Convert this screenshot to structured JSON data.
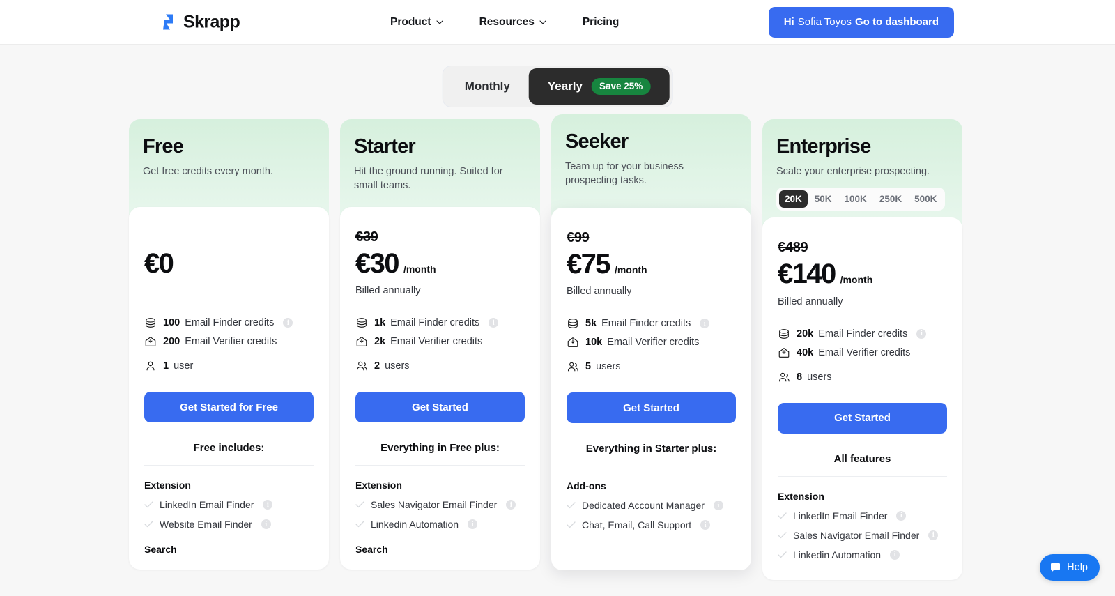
{
  "header": {
    "logo_text": "Skrapp",
    "nav": [
      {
        "label": "Product",
        "has_chevron": true
      },
      {
        "label": "Resources",
        "has_chevron": true
      },
      {
        "label": "Pricing",
        "has_chevron": false
      }
    ],
    "cta": {
      "greeting": "Hi",
      "username": "Sofia Toyos",
      "action": "Go to dashboard"
    },
    "accent_color": "#386bf0"
  },
  "billing_toggle": {
    "monthly_label": "Monthly",
    "yearly_label": "Yearly",
    "save_badge": "Save 25%",
    "selected": "Yearly",
    "badge_color": "#17853f",
    "active_bg": "#2c2c2c"
  },
  "plans": [
    {
      "name": "Free",
      "description": "Get free credits every month.",
      "price_old": "",
      "price": "€0",
      "per": "",
      "billed": "",
      "credits": [
        {
          "amount": "100",
          "label": "Email Finder credits",
          "info": true,
          "icon": "coins-icon"
        },
        {
          "amount": "200",
          "label": "Email Verifier credits",
          "info": false,
          "icon": "envelope-download-icon"
        }
      ],
      "users": {
        "amount": "1",
        "label": "user",
        "icon": "user-icon"
      },
      "cta_label": "Get Started for Free",
      "includes_title": "Free includes:",
      "feature_groups": [
        {
          "title": "Extension",
          "items": [
            {
              "label": "LinkedIn Email Finder",
              "info": true
            },
            {
              "label": "Website Email Finder",
              "info": true
            }
          ]
        },
        {
          "title": "Search",
          "items": []
        }
      ]
    },
    {
      "name": "Starter",
      "description": "Hit the ground running. Suited for small teams.",
      "price_old": "€39",
      "price": "€30",
      "per": "/month",
      "billed": "Billed annually",
      "credits": [
        {
          "amount": "1k",
          "label": "Email Finder credits",
          "info": true,
          "icon": "coins-icon"
        },
        {
          "amount": "2k",
          "label": "Email Verifier credits",
          "info": false,
          "icon": "envelope-download-icon"
        }
      ],
      "users": {
        "amount": "2",
        "label": "users",
        "icon": "users-icon"
      },
      "cta_label": "Get Started",
      "includes_title": "Everything in Free plus:",
      "feature_groups": [
        {
          "title": "Extension",
          "items": [
            {
              "label": "Sales Navigator Email Finder",
              "info": true
            },
            {
              "label": "Linkedin Automation",
              "info": true
            }
          ]
        },
        {
          "title": "Search",
          "items": []
        }
      ]
    },
    {
      "name": "Seeker",
      "description": "Team up for your business prospecting tasks.",
      "price_old": "€99",
      "price": "€75",
      "per": "/month",
      "billed": "Billed annually",
      "credits": [
        {
          "amount": "5k",
          "label": "Email Finder credits",
          "info": true,
          "icon": "coins-icon"
        },
        {
          "amount": "10k",
          "label": "Email Verifier credits",
          "info": false,
          "icon": "envelope-download-icon"
        }
      ],
      "users": {
        "amount": "5",
        "label": "users",
        "icon": "users-icon"
      },
      "cta_label": "Get Started",
      "includes_title": "Everything in Starter plus:",
      "feature_groups": [
        {
          "title": "Add-ons",
          "items": [
            {
              "label": "Dedicated Account Manager",
              "info": true
            },
            {
              "label": "Chat, Email, Call Support",
              "info": true
            }
          ]
        }
      ]
    },
    {
      "name": "Enterprise",
      "description": "Scale your enterprise prospecting.",
      "tiers": [
        "20K",
        "50K",
        "100K",
        "250K",
        "500K"
      ],
      "tier_selected": "20K",
      "price_old": "€489",
      "price": "€140",
      "per": "/month",
      "billed": "Billed annually",
      "credits": [
        {
          "amount": "20k",
          "label": "Email Finder credits",
          "info": true,
          "icon": "coins-icon"
        },
        {
          "amount": "40k",
          "label": "Email Verifier credits",
          "info": false,
          "icon": "envelope-download-icon"
        }
      ],
      "users": {
        "amount": "8",
        "label": "users",
        "icon": "users-icon"
      },
      "cta_label": "Get Started",
      "includes_title": "All features",
      "feature_groups": [
        {
          "title": "Extension",
          "items": [
            {
              "label": "LinkedIn Email Finder",
              "info": true
            },
            {
              "label": "Sales Navigator Email Finder",
              "info": true
            },
            {
              "label": "Linkedin Automation",
              "info": true
            }
          ]
        }
      ]
    }
  ],
  "help_widget": {
    "label": "Help",
    "icon": "chat-bubble-icon",
    "color": "#1877f2"
  }
}
